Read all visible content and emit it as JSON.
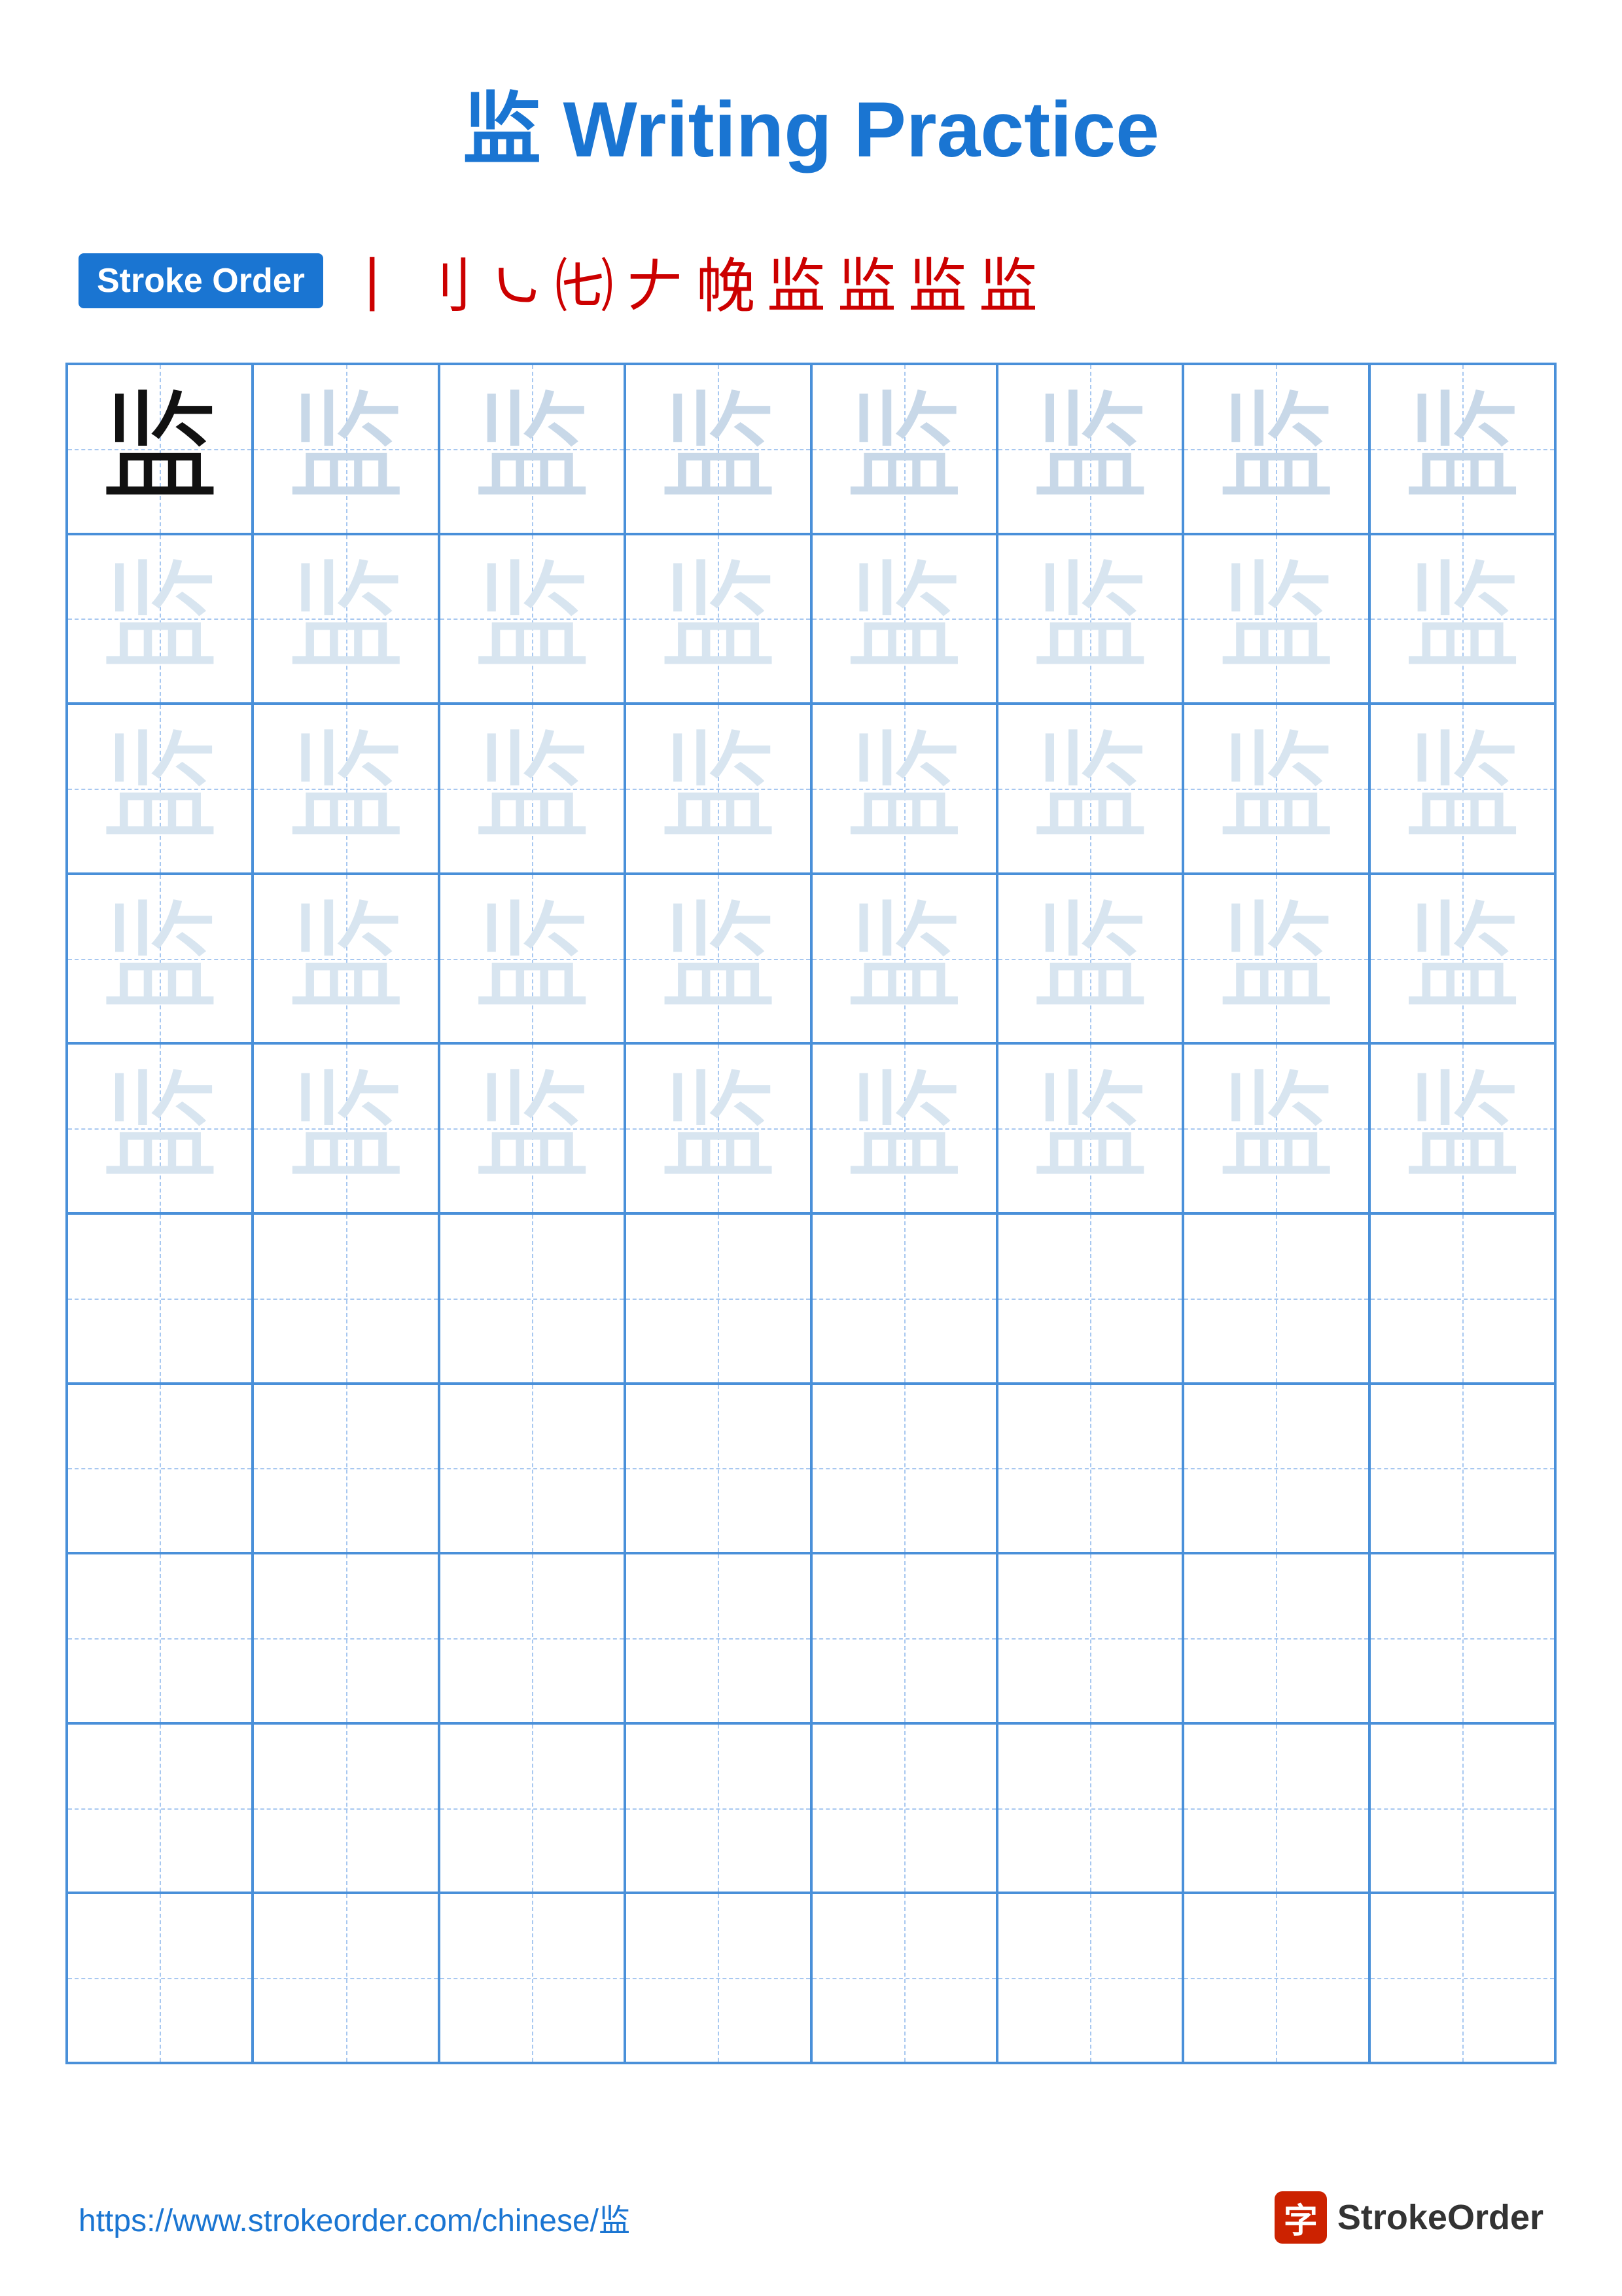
{
  "title": {
    "char": "监",
    "label": "Writing Practice"
  },
  "stroke_order": {
    "badge_label": "Stroke Order",
    "chars": [
      "丨",
      "刂",
      "㇃",
      "㇂",
      "㕁",
      "㐄",
      "监",
      "监",
      "监",
      "监"
    ]
  },
  "grid": {
    "rows": 10,
    "cols": 8,
    "practice_char": "监"
  },
  "footer": {
    "url": "https://www.strokeorder.com/chinese/监",
    "brand": "StrokeOrder",
    "brand_char": "字"
  }
}
